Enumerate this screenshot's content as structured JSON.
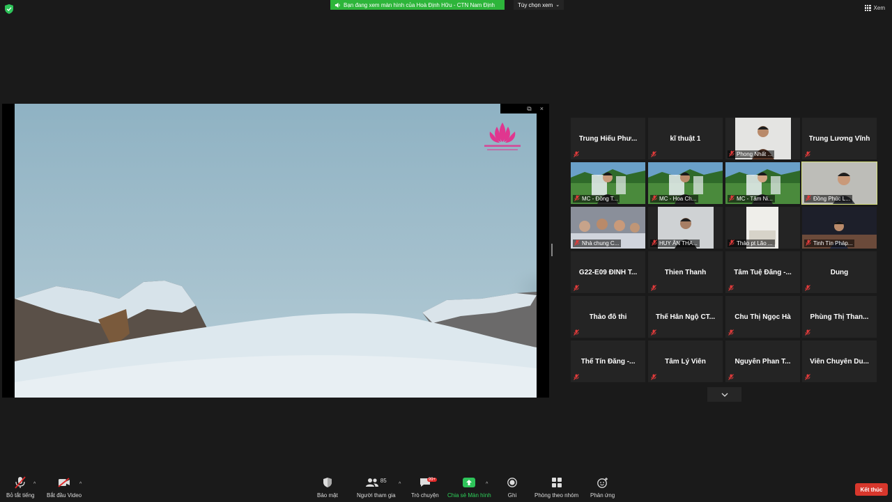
{
  "top": {
    "share_banner": "Bạn đang xem màn hình của Hoà Định Hữu - CTN Nam Định",
    "view_options": "Tùy chọn xem",
    "view_label": "Xem"
  },
  "gallery": [
    {
      "name": "Trung Hiếu Phư...",
      "video": false
    },
    {
      "name": "kĩ thuật 1",
      "video": false
    },
    {
      "name": "Phong Nhất ...",
      "video": true
    },
    {
      "name": "Trung Lương Vĩnh",
      "video": false
    },
    {
      "name": "MC - Đồng T...",
      "video": true
    },
    {
      "name": "MC - Hoa Ch...",
      "video": true
    },
    {
      "name": "MC - Tâm Ni...",
      "video": true
    },
    {
      "name": "Đồng Phúc L...",
      "video": true,
      "active": true
    },
    {
      "name": "Nhà chung C...",
      "video": true
    },
    {
      "name": "HUY ÂN THA...",
      "video": true
    },
    {
      "name": "Thảo pt Lão ...",
      "video": true
    },
    {
      "name": "Tinh Tín Pháp...",
      "video": true
    },
    {
      "name": "G22-E09 ĐINH T...",
      "video": false
    },
    {
      "name": "Thien Thanh",
      "video": false
    },
    {
      "name": "Tâm Tuệ Đăng -...",
      "video": false
    },
    {
      "name": "Dung",
      "video": false
    },
    {
      "name": "Thảo đỗ thi",
      "video": false
    },
    {
      "name": "Thể Hân Ngộ CT...",
      "video": false
    },
    {
      "name": "Chu Thị Ngọc Hà",
      "video": false
    },
    {
      "name": "Phùng Thị Than...",
      "video": false
    },
    {
      "name": "Thể Tín Đăng -...",
      "video": false
    },
    {
      "name": "Tâm Lý Viên",
      "video": false
    },
    {
      "name": "Nguyễn Phan T...",
      "video": false
    },
    {
      "name": "Viên Chuyên Du...",
      "video": false
    }
  ],
  "toolbar": {
    "mute": "Bỏ tắt tiếng",
    "video": "Bắt đầu Video",
    "security": "Bảo mật",
    "participants": "Người tham gia",
    "participant_count": "85",
    "chat": "Trò chuyện",
    "chat_badge": "99+",
    "share": "Chia sẻ Màn hình",
    "record": "Ghi",
    "breakout": "Phòng theo nhóm",
    "reactions": "Phản ứng",
    "end": "Kết thúc"
  },
  "colors": {
    "share_green": "#2db53a",
    "end_red": "#d8372c",
    "active_speaker": "#d8e27c"
  }
}
